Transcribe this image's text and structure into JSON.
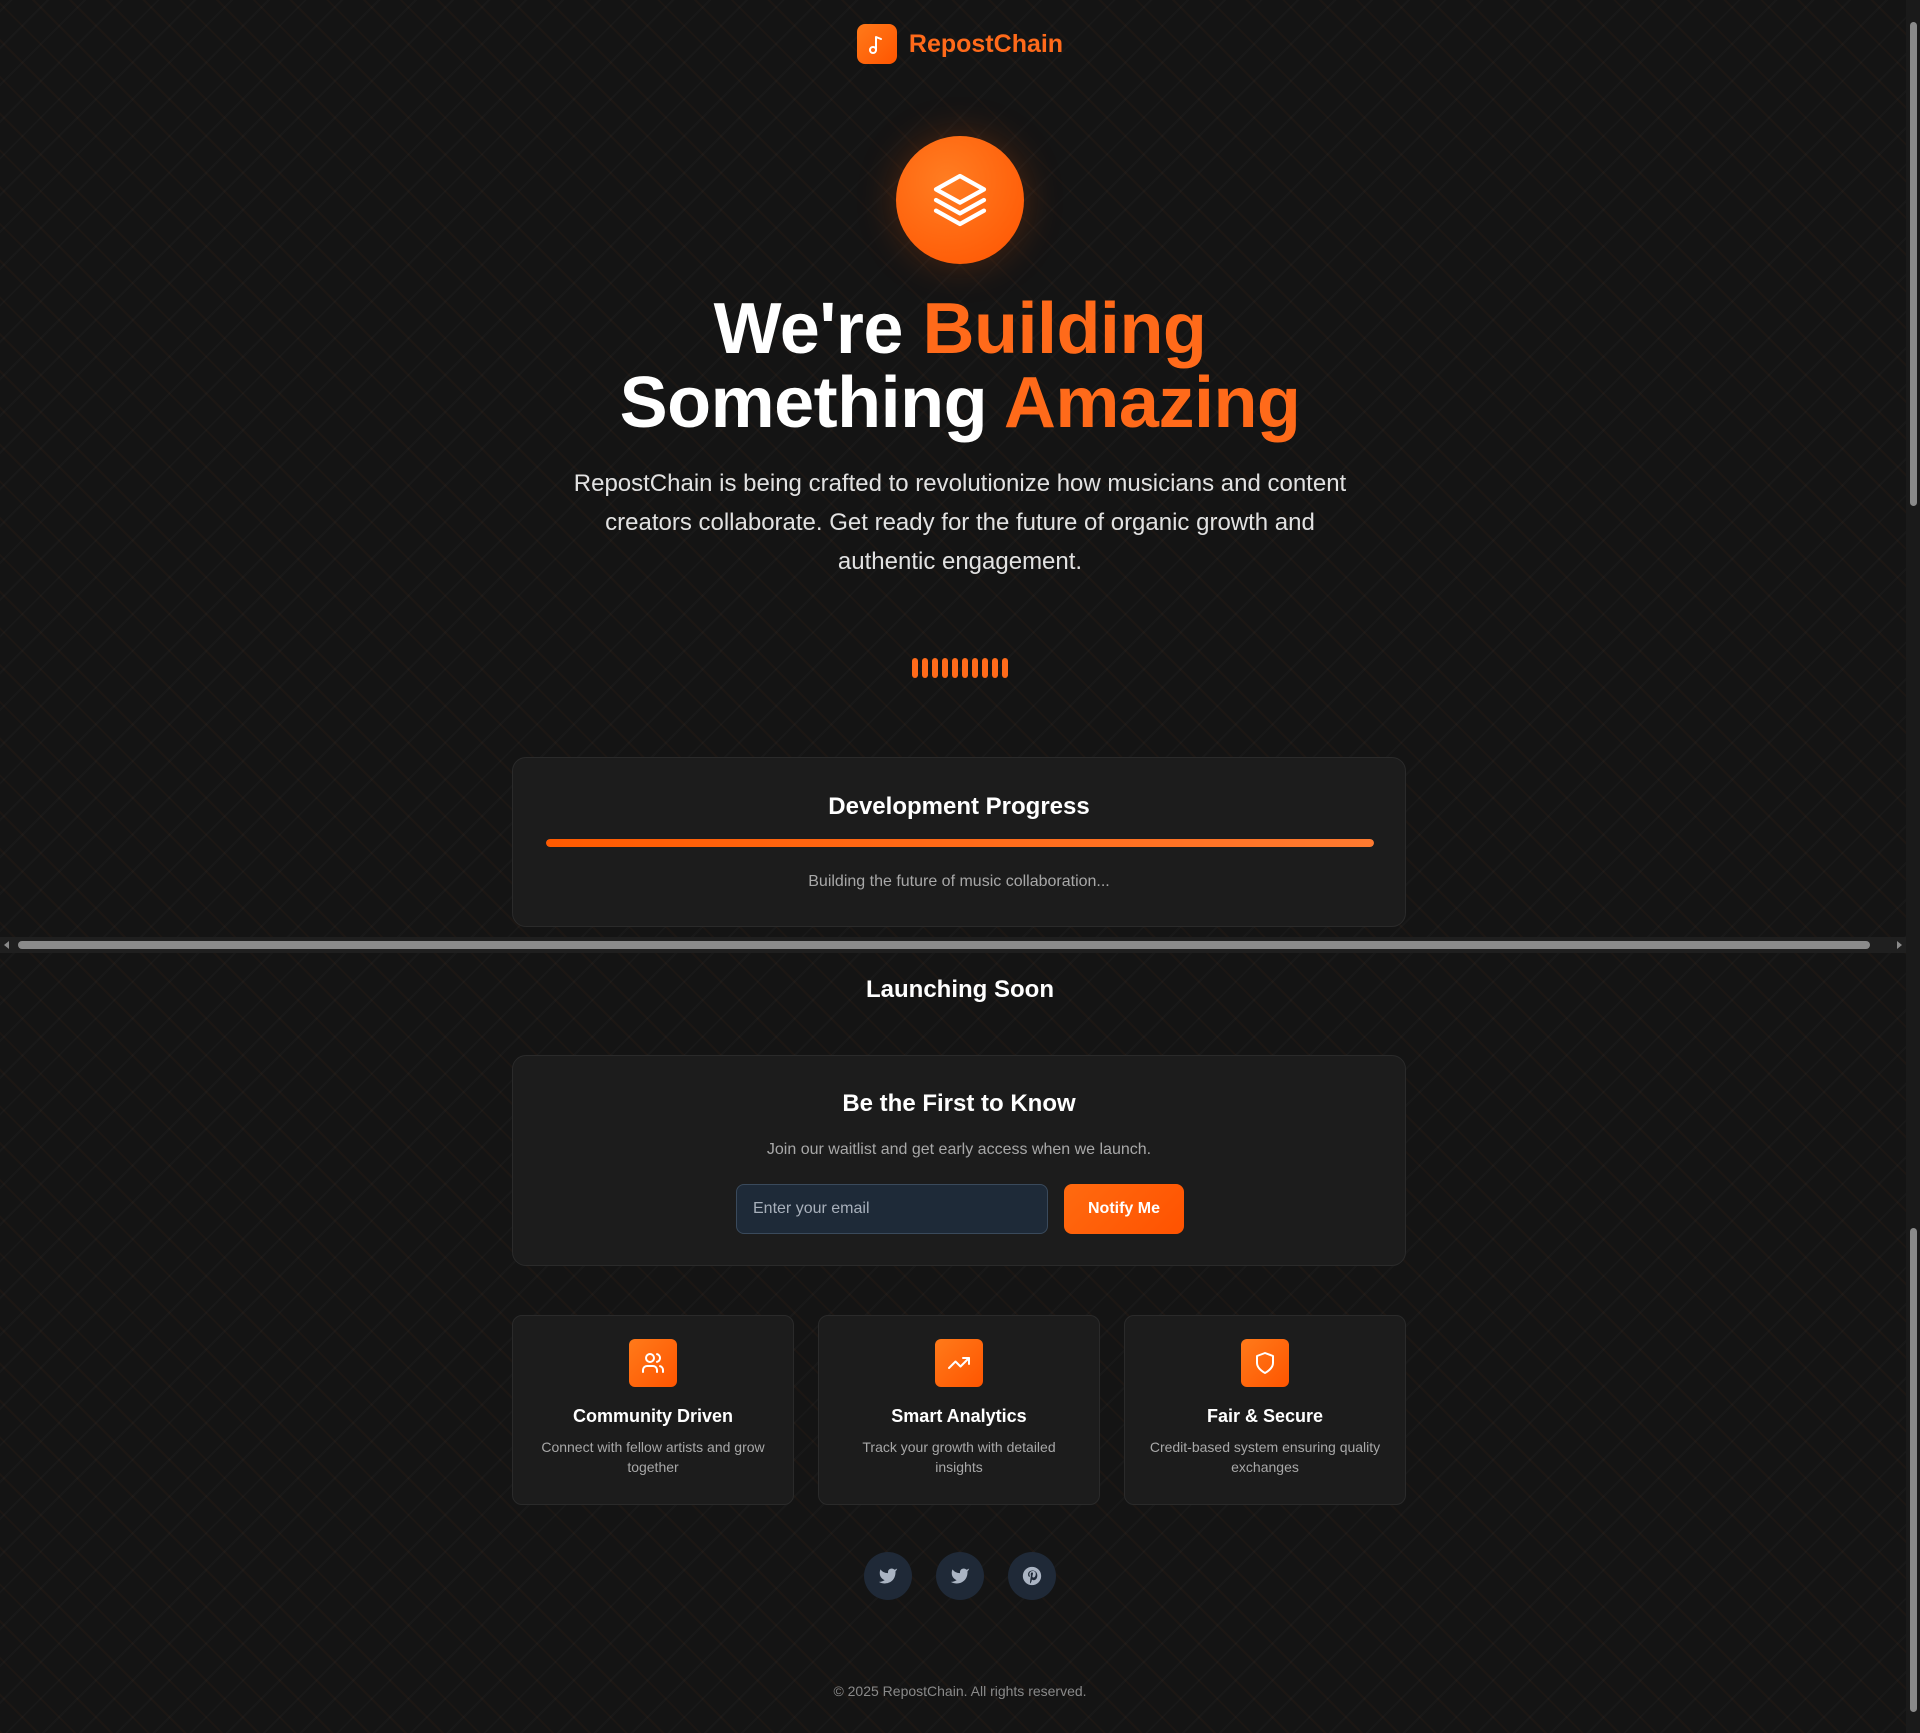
{
  "brand": {
    "name": "RepostChain",
    "logo_icon": "music-note-icon"
  },
  "hero": {
    "badge_icon": "layers-icon",
    "headline_part1": "We're ",
    "headline_part1_accent": "Building",
    "headline_part2": "Something ",
    "headline_part2_accent": "Amazing",
    "description": "RepostChain is being crafted to revolutionize how musicians and content creators collaborate. Get ready for the future of organic growth and authentic engagement."
  },
  "progress": {
    "title": "Development Progress",
    "percent": 100,
    "caption": "Building the future of music collaboration..."
  },
  "launching": {
    "title": "Launching Soon"
  },
  "waitlist": {
    "title": "Be the First to Know",
    "subtitle": "Join our waitlist and get early access when we launch.",
    "email_placeholder": "Enter your email",
    "email_value": "",
    "button_label": "Notify Me"
  },
  "features": [
    {
      "icon": "users-icon",
      "title": "Community Driven",
      "description": "Connect with fellow artists and grow together"
    },
    {
      "icon": "trending-up-icon",
      "title": "Smart Analytics",
      "description": "Track your growth with detailed insights"
    },
    {
      "icon": "shield-icon",
      "title": "Fair & Secure",
      "description": "Credit-based system ensuring quality exchanges"
    }
  ],
  "socials": [
    {
      "icon": "twitter-icon"
    },
    {
      "icon": "twitter-icon"
    },
    {
      "icon": "pinterest-icon"
    }
  ],
  "footer": {
    "copyright": "© 2025 RepostChain. All rights reserved."
  },
  "colors": {
    "accent": "#ff6a1a",
    "background": "#141414",
    "card": "#1c1c1c",
    "social_bg": "#1f2937"
  }
}
